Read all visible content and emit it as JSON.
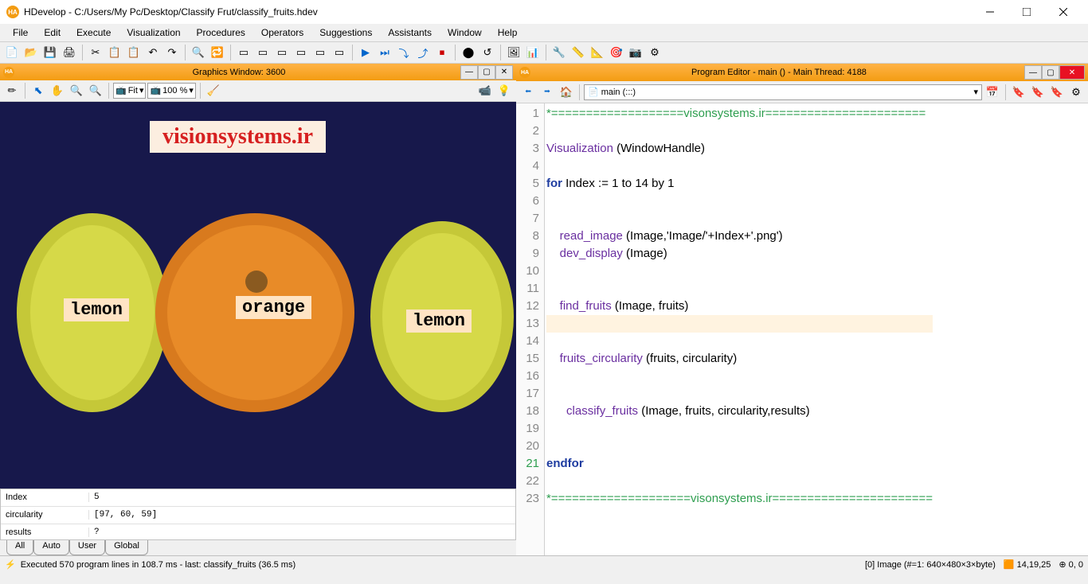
{
  "title": "HDevelop - C:/Users/My Pc/Desktop/Classify Frut/classify_fruits.hdev",
  "menu": [
    "File",
    "Edit",
    "Execute",
    "Visualization",
    "Procedures",
    "Operators",
    "Suggestions",
    "Assistants",
    "Window",
    "Help"
  ],
  "graphics_window_title": "Graphics Window: 3600",
  "program_editor_title": "Program Editor - main () - Main Thread: 4188",
  "gw_fit": "Fit",
  "gw_zoom": "100 %",
  "pe_proc": "main (:::)",
  "watermark": "visionsystems.ir",
  "fruits": {
    "lemon1": "lemon",
    "orange": "orange",
    "lemon2": "lemon"
  },
  "vars": [
    {
      "name": "Index",
      "val": "5"
    },
    {
      "name": "circularity",
      "val": "[97, 60, 59]"
    },
    {
      "name": "results",
      "val": "?"
    }
  ],
  "var_tabs": [
    "All",
    "Auto",
    "User",
    "Global"
  ],
  "code": [
    {
      "n": 1,
      "cls": "comment",
      "text": "*===================visonsystems.ir======================="
    },
    {
      "n": 2,
      "cls": "",
      "text": ""
    },
    {
      "n": 3,
      "cls": "call",
      "ident": "Visualization",
      "args": " (WindowHandle)"
    },
    {
      "n": 4,
      "cls": "",
      "text": ""
    },
    {
      "n": 5,
      "cls": "kw",
      "kwtext": "for ",
      "rest": "Index := 1 to 14 by 1"
    },
    {
      "n": 6,
      "cls": "",
      "text": ""
    },
    {
      "n": 7,
      "cls": "",
      "text": ""
    },
    {
      "n": 8,
      "cls": "call",
      "pad": "    ",
      "ident": "read_image",
      "args": " (Image,'Image/'+Index+'.png')"
    },
    {
      "n": 9,
      "cls": "call",
      "pad": "    ",
      "ident": "dev_display",
      "args": " (Image)"
    },
    {
      "n": 10,
      "cls": "",
      "text": ""
    },
    {
      "n": 11,
      "cls": "",
      "text": ""
    },
    {
      "n": 12,
      "cls": "call",
      "pad": "    ",
      "ident": "find_fruits",
      "args": " (Image, fruits)"
    },
    {
      "n": 13,
      "cls": "hl",
      "text": ""
    },
    {
      "n": 14,
      "cls": "",
      "text": ""
    },
    {
      "n": 15,
      "cls": "call",
      "pad": "    ",
      "ident": "fruits_circularity",
      "args": " (fruits, circularity)"
    },
    {
      "n": 16,
      "cls": "",
      "text": ""
    },
    {
      "n": 17,
      "cls": "",
      "text": ""
    },
    {
      "n": 18,
      "cls": "call",
      "pad": "      ",
      "ident": "classify_fruits",
      "args": " (Image, fruits, circularity,results)"
    },
    {
      "n": 19,
      "cls": "",
      "text": ""
    },
    {
      "n": 20,
      "cls": "",
      "text": ""
    },
    {
      "n": 21,
      "cls": "kw",
      "kwtext": "endfor",
      "rest": ""
    },
    {
      "n": 22,
      "cls": "",
      "text": ""
    },
    {
      "n": 23,
      "cls": "comment",
      "text": "*====================visonsystems.ir======================="
    }
  ],
  "status_exec": "Executed 570 program lines in 108.7 ms - last: classify_fruits (36.5 ms)",
  "status_image": "[0] Image (#=1: 640×480×3×byte)",
  "status_coords": "14,19,25",
  "status_pos": "0, 0"
}
